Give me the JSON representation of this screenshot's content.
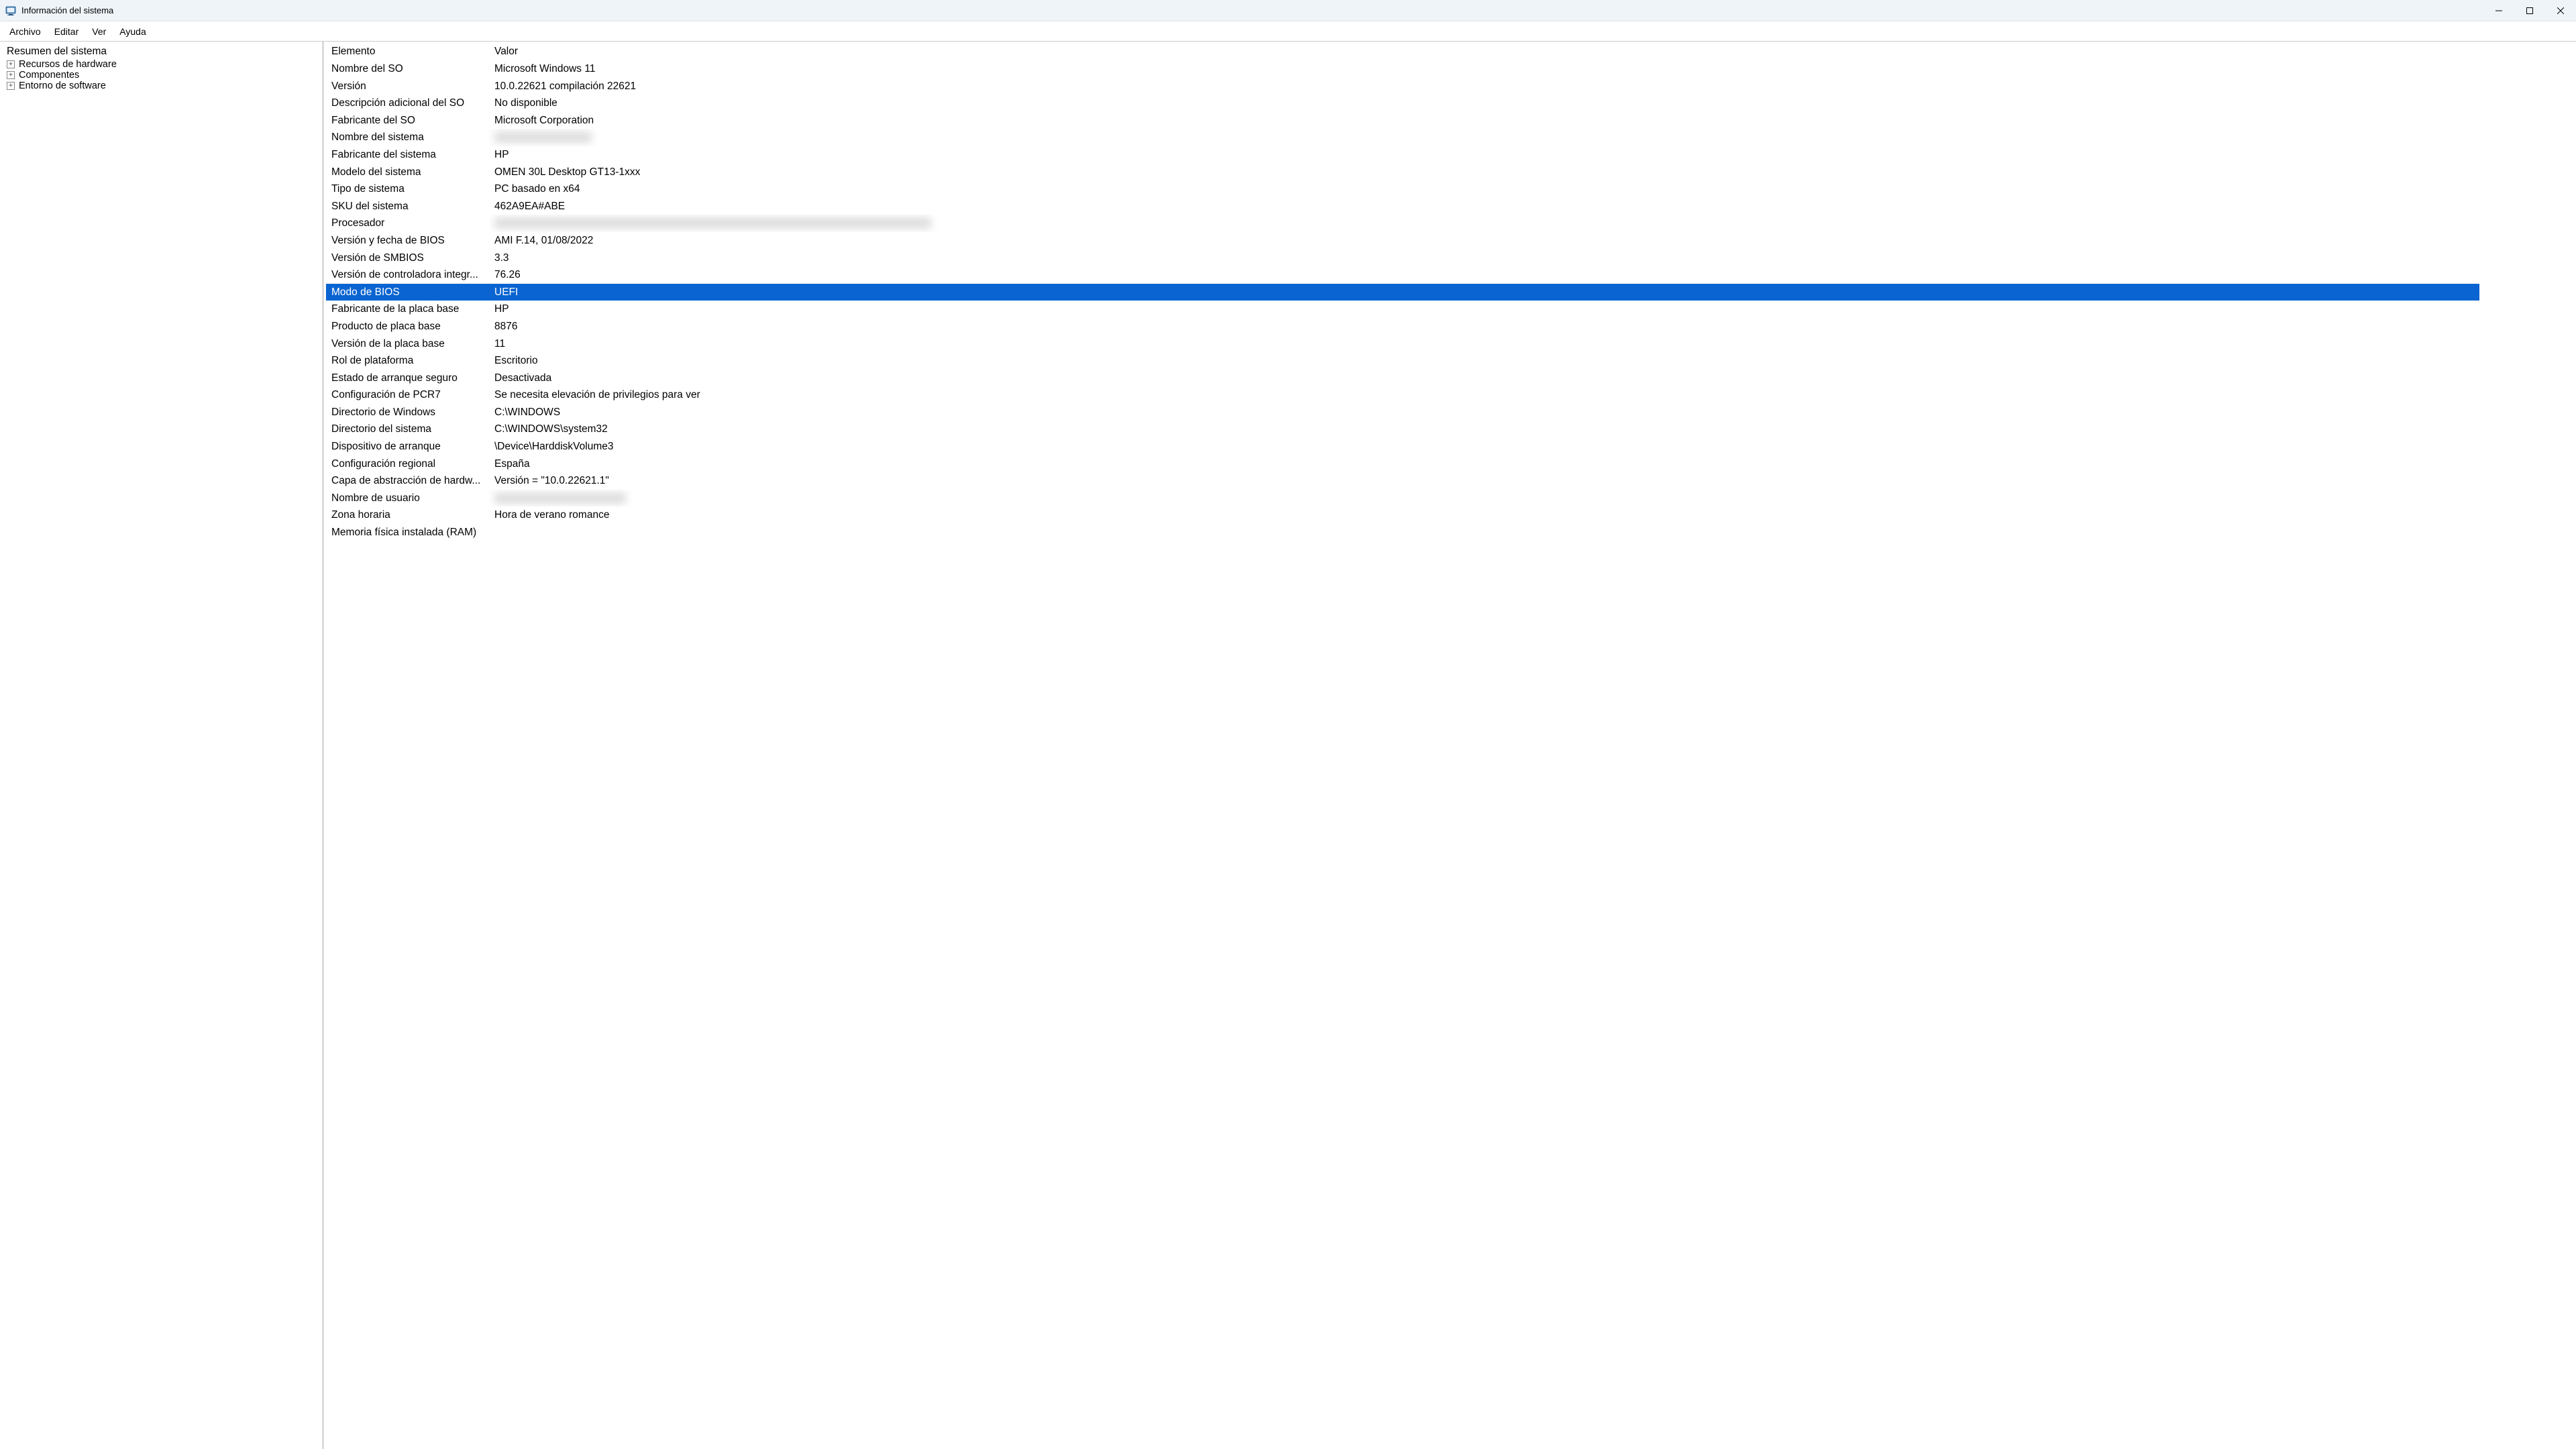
{
  "window": {
    "title": "Información del sistema"
  },
  "menu": {
    "file": "Archivo",
    "edit": "Editar",
    "view": "Ver",
    "help": "Ayuda"
  },
  "tree": {
    "root": "Resumen del sistema",
    "nodes": [
      {
        "label": "Recursos de hardware"
      },
      {
        "label": "Componentes"
      },
      {
        "label": "Entorno de software"
      }
    ]
  },
  "columns": {
    "element": "Elemento",
    "value": "Valor"
  },
  "rows": [
    {
      "element": "Nombre del SO",
      "value": "Microsoft Windows 11",
      "selected": false,
      "blurred": false
    },
    {
      "element": "Versión",
      "value": "10.0.22621 compilación 22621",
      "selected": false,
      "blurred": false
    },
    {
      "element": "Descripción adicional del SO",
      "value": "No disponible",
      "selected": false,
      "blurred": false
    },
    {
      "element": "Fabricante del SO",
      "value": "Microsoft Corporation",
      "selected": false,
      "blurred": false
    },
    {
      "element": "Nombre del sistema",
      "value": "XXXXXXXXXXXXXX",
      "selected": false,
      "blurred": true
    },
    {
      "element": "Fabricante del sistema",
      "value": "HP",
      "selected": false,
      "blurred": false
    },
    {
      "element": "Modelo del sistema",
      "value": "OMEN 30L Desktop GT13-1xxx",
      "selected": false,
      "blurred": false
    },
    {
      "element": "Tipo de sistema",
      "value": "PC basado en x64",
      "selected": false,
      "blurred": false
    },
    {
      "element": "SKU del sistema",
      "value": "462A9EA#ABE",
      "selected": false,
      "blurred": false
    },
    {
      "element": "Procesador",
      "value": "XXXXXXXXXXXXXXXXXXXXXXXXXXXXXXXXXXXXXXXXXXXXXXXXXXXXXXXXXXXXXXX",
      "selected": false,
      "blurred": true
    },
    {
      "element": "Versión y fecha de BIOS",
      "value": "AMI F.14, 01/08/2022",
      "selected": false,
      "blurred": false
    },
    {
      "element": "Versión de SMBIOS",
      "value": "3.3",
      "selected": false,
      "blurred": false
    },
    {
      "element": "Versión de controladora integr...",
      "value": "76.26",
      "selected": false,
      "blurred": false
    },
    {
      "element": "Modo de BIOS",
      "value": "UEFI",
      "selected": true,
      "blurred": false
    },
    {
      "element": "Fabricante de la placa base",
      "value": "HP",
      "selected": false,
      "blurred": false
    },
    {
      "element": "Producto de placa base",
      "value": "8876",
      "selected": false,
      "blurred": false
    },
    {
      "element": "Versión de la placa base",
      "value": "11",
      "selected": false,
      "blurred": false
    },
    {
      "element": "Rol de plataforma",
      "value": "Escritorio",
      "selected": false,
      "blurred": false
    },
    {
      "element": "Estado de arranque seguro",
      "value": "Desactivada",
      "selected": false,
      "blurred": false
    },
    {
      "element": "Configuración de PCR7",
      "value": "Se necesita elevación de privilegios para ver",
      "selected": false,
      "blurred": false
    },
    {
      "element": "Directorio de Windows",
      "value": "C:\\WINDOWS",
      "selected": false,
      "blurred": false
    },
    {
      "element": "Directorio del sistema",
      "value": "C:\\WINDOWS\\system32",
      "selected": false,
      "blurred": false
    },
    {
      "element": "Dispositivo de arranque",
      "value": "\\Device\\HarddiskVolume3",
      "selected": false,
      "blurred": false
    },
    {
      "element": "Configuración regional",
      "value": "España",
      "selected": false,
      "blurred": false
    },
    {
      "element": "Capa de abstracción de hardw...",
      "value": "Versión = \"10.0.22621.1\"",
      "selected": false,
      "blurred": false
    },
    {
      "element": "Nombre de usuario",
      "value": "XXXXXXXXXXXXXXXXXXX",
      "selected": false,
      "blurred": true
    },
    {
      "element": "Zona horaria",
      "value": "Hora de verano romance",
      "selected": false,
      "blurred": false
    },
    {
      "element": "Memoria física instalada (RAM)",
      "value": "",
      "selected": false,
      "blurred": false
    }
  ]
}
